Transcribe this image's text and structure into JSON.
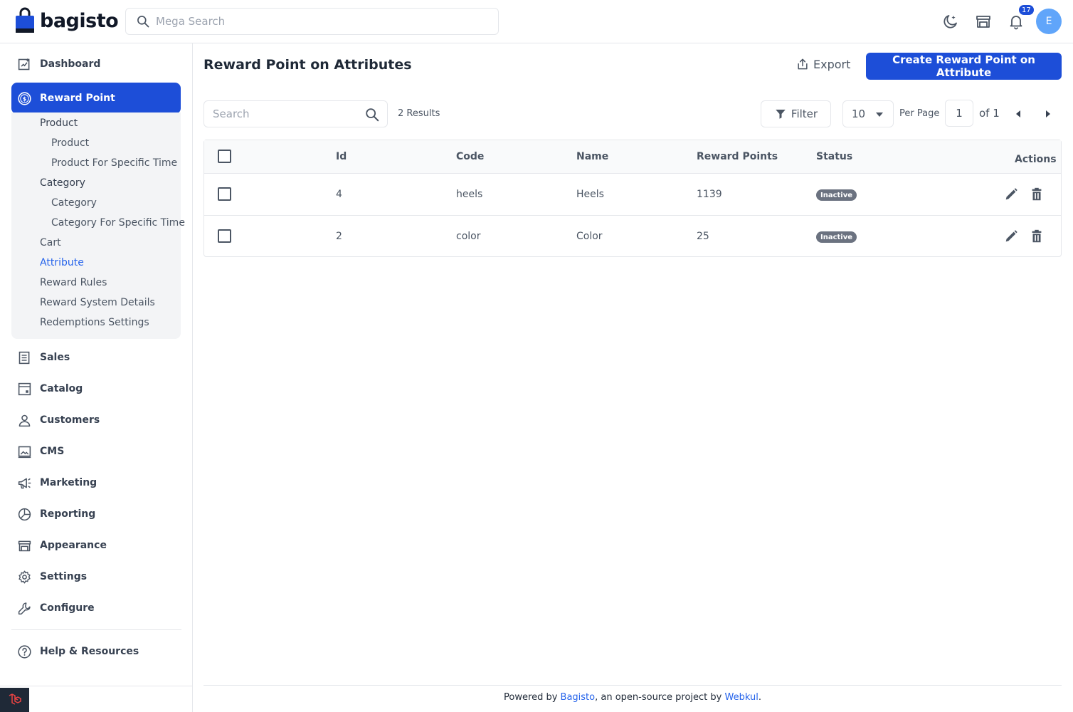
{
  "brand": {
    "name": "bagisto",
    "accent": "#1d4ed8"
  },
  "header": {
    "search_placeholder": "Mega Search",
    "notification_count": "17",
    "avatar_initial": "E"
  },
  "sidebar": {
    "items": [
      {
        "label": "Dashboard",
        "icon": "dashboard-icon"
      },
      {
        "label": "Reward Point",
        "icon": "dollar-circle-icon",
        "active": true
      },
      {
        "label": "Sales",
        "icon": "sales-icon"
      },
      {
        "label": "Catalog",
        "icon": "catalog-icon"
      },
      {
        "label": "Customers",
        "icon": "customer-icon"
      },
      {
        "label": "CMS",
        "icon": "cms-icon"
      },
      {
        "label": "Marketing",
        "icon": "megaphone-icon"
      },
      {
        "label": "Reporting",
        "icon": "pie-chart-icon"
      },
      {
        "label": "Appearance",
        "icon": "store-icon"
      },
      {
        "label": "Settings",
        "icon": "gear-icon"
      },
      {
        "label": "Configure",
        "icon": "wrench-icon"
      }
    ],
    "submenu": {
      "product_group": "Product",
      "product": "Product",
      "product_time": "Product For Specific Time",
      "category_group": "Category",
      "category": "Category",
      "category_time": "Category For Specific Time",
      "cart": "Cart",
      "attribute": "Attribute",
      "reward_rules": "Reward Rules",
      "reward_system_details": "Reward System Details",
      "redemptions_settings": "Redemptions Settings"
    },
    "help": "Help & Resources"
  },
  "main": {
    "title": "Reward Point on Attributes",
    "export_label": "Export",
    "create_label": "Create Reward Point on Attribute",
    "search_placeholder": "Search",
    "results": "2 Results",
    "filter_label": "Filter",
    "per_page_value": "10",
    "per_page_label": "Per Page",
    "page_current": "1",
    "page_of": "of 1"
  },
  "table": {
    "columns": [
      "Id",
      "Code",
      "Name",
      "Reward Points",
      "Status",
      "Actions"
    ],
    "rows": [
      {
        "id": "4",
        "code": "heels",
        "name": "Heels",
        "points": "1139",
        "status": "Inactive"
      },
      {
        "id": "2",
        "code": "color",
        "name": "Color",
        "points": "25",
        "status": "Inactive"
      }
    ]
  },
  "footer": {
    "prefix": "Powered by ",
    "bagisto": "Bagisto",
    "middle": ", an open-source project by ",
    "webkul": "Webkul",
    "suffix": "."
  }
}
